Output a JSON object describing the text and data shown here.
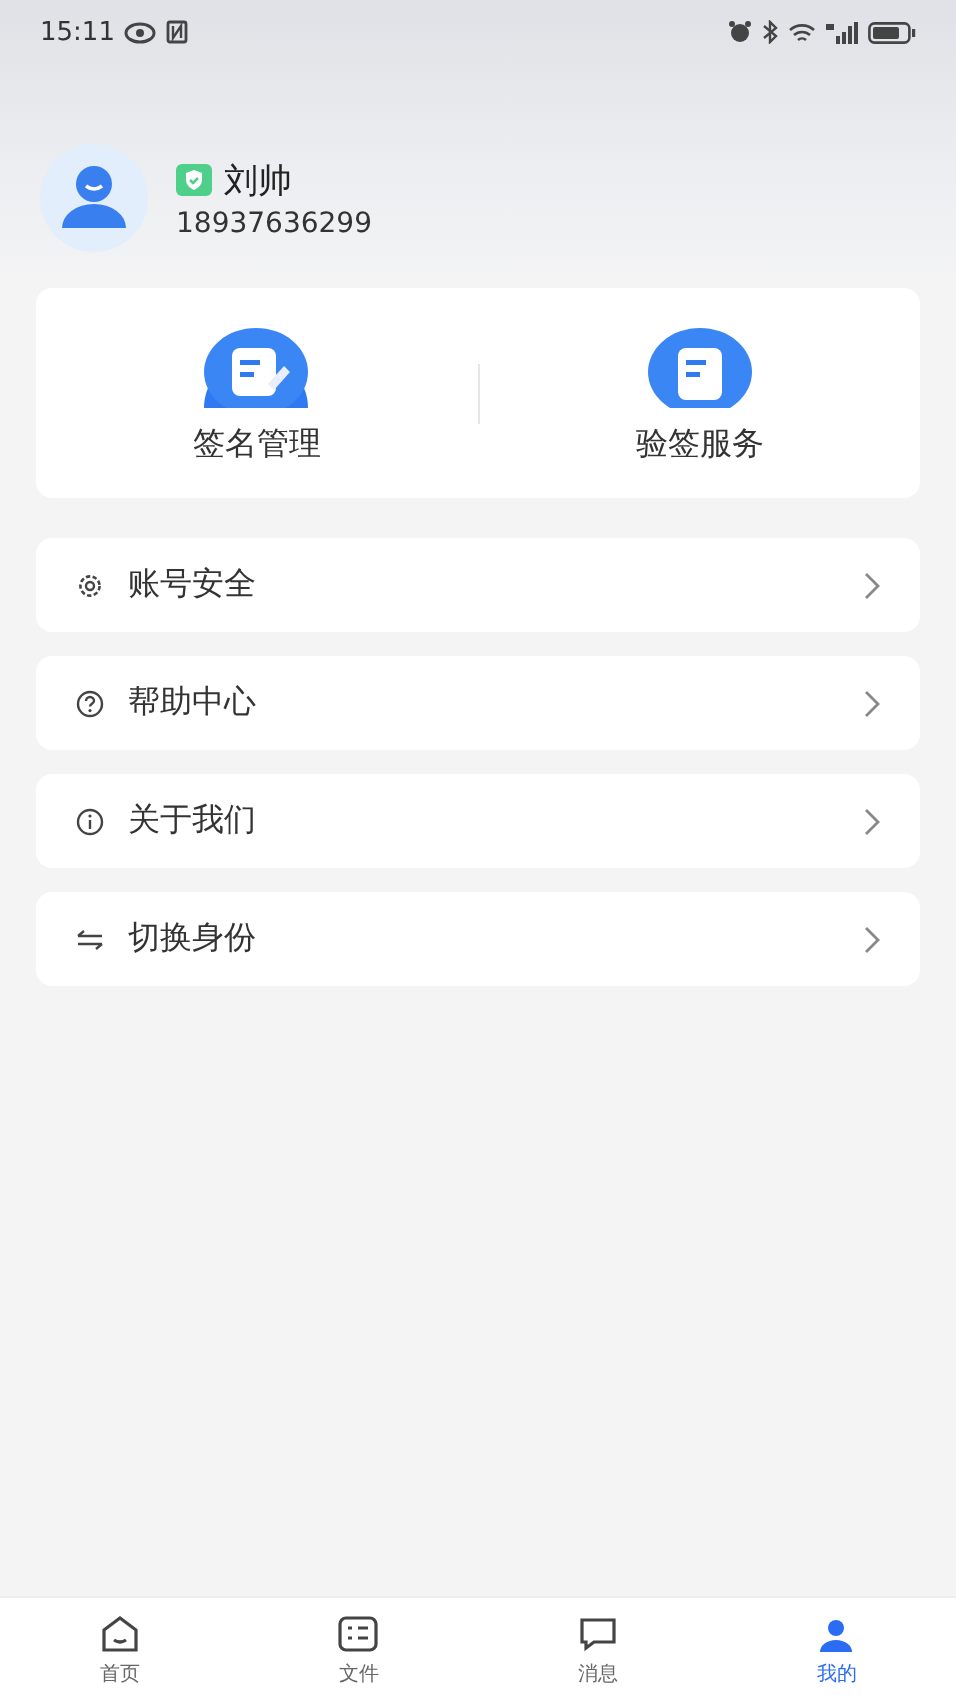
{
  "status_bar": {
    "time": "15:11"
  },
  "profile": {
    "name": "刘帅",
    "phone": "18937636299",
    "verified": true
  },
  "services": [
    {
      "label": "签名管理",
      "kind": "sign"
    },
    {
      "label": "验签服务",
      "kind": "verify"
    }
  ],
  "menu": [
    {
      "label": "账号安全",
      "kind": "security"
    },
    {
      "label": "帮助中心",
      "kind": "help"
    },
    {
      "label": "关于我们",
      "kind": "about"
    },
    {
      "label": "切换身份",
      "kind": "switch"
    }
  ],
  "tabs": [
    {
      "label": "首页",
      "kind": "home",
      "selected": false
    },
    {
      "label": "文件",
      "kind": "files",
      "selected": false
    },
    {
      "label": "消息",
      "kind": "messages",
      "selected": false
    },
    {
      "label": "我的",
      "kind": "me",
      "selected": true
    }
  ]
}
